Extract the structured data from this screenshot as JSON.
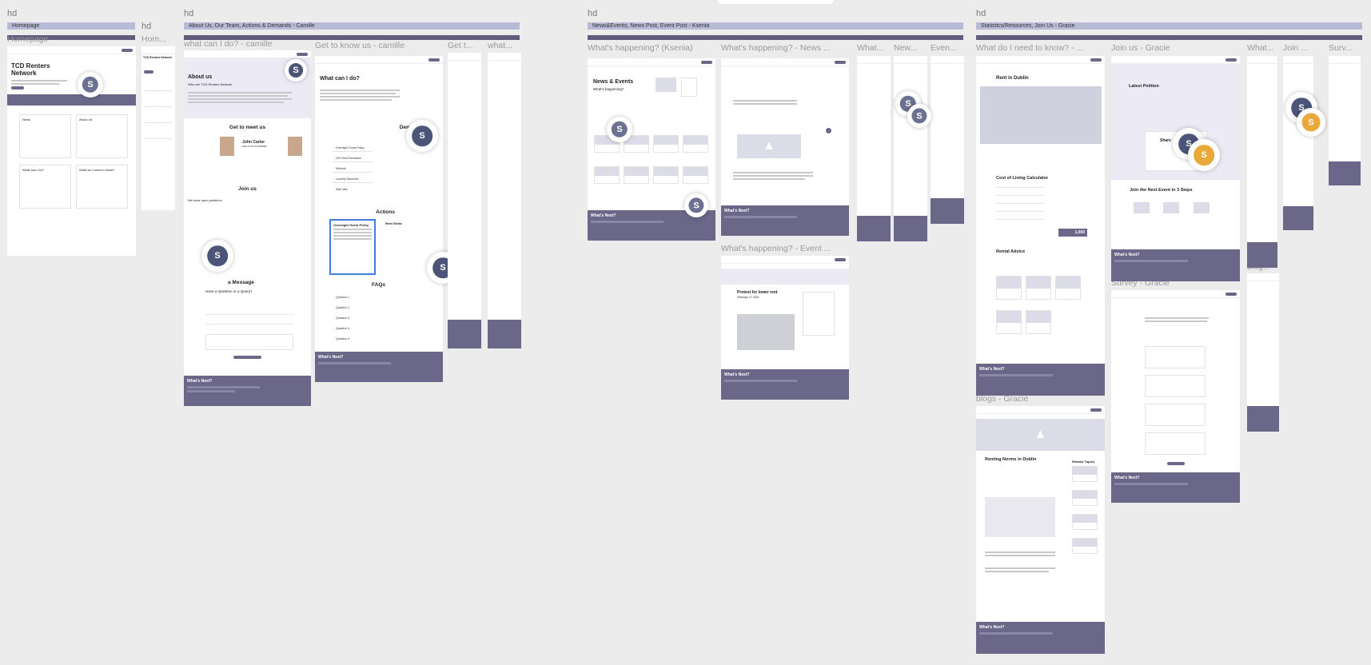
{
  "canvas": {
    "sections": [
      {
        "hd": "hd",
        "bar": "Homepage"
      },
      {
        "hd": "hd",
        "bar": "About Us, Our Team, Actions & Demands - Camille"
      },
      {
        "hd": "hd",
        "bar": "News&Events, News Post, Event Post - Ksenia"
      },
      {
        "hd": "hd",
        "bar": "Statistics/Resources, Join Us - Gracie"
      }
    ],
    "extra_hd": [
      "hd",
      "hd",
      "hd",
      "hd"
    ],
    "frame_labels": {
      "homepage": "Homepage",
      "homepage_mobile": "Hom...",
      "what_can_i_do": "what can I do? - camille",
      "get_to_know": "Get to know us - camille",
      "get_t": "Get t...",
      "what_mob": "what...",
      "whats_happening": "What's happening?  (Ksenia)",
      "whats_news": "What's happening? - News ...",
      "what_mob2": "What...",
      "new_mob": "New...",
      "even_mob": "Even...",
      "whats_event": "What's happening? - Event ...",
      "what_do_i_need": "What do I need to know? - ...",
      "join_us": "Join us - Gracie",
      "what_mob3": "What...",
      "join_mob": "Join ...",
      "surv_mob": "Surv...",
      "survey": "Survey - Gracie",
      "blogs": "blogs - Gracie",
      "blog_mob": "blog..."
    }
  },
  "avatar_letter": "S",
  "homepage": {
    "hero_title": "TCD Renters Network",
    "cards": [
      "News",
      "About Us",
      "What can I do?",
      "What do I need to know?"
    ]
  },
  "about": {
    "title": "About us",
    "subtitle": "Who are TCD Renters Network",
    "meet": "Get to meet us",
    "person_name": "John Carter",
    "person_role": "CEO & CO-FOUNDER",
    "join": "Join us",
    "open": "We have open positions",
    "message": "a Message",
    "question": "Have a Question or a Query?",
    "whats_next": "What's Next?"
  },
  "whatcan": {
    "title": "What can I do?",
    "demands": "Demands",
    "demand_items": [
      "Overnight Guest Policy",
      "20% Rent Reduction",
      "Refunds",
      "Laundry Machines",
      "Staff ratio"
    ],
    "actions": "Actions",
    "action_1": "Overnight Guest Policy",
    "action_2": "Rent Strike",
    "faqs": "FAQs",
    "faq_items": [
      "Question 1",
      "Question 2",
      "Question 3",
      "Question 4",
      "Question 5"
    ]
  },
  "news": {
    "title": "News & Events",
    "subtitle": "What's happening?",
    "post_title": "Protest for lower rent",
    "post_date": "February 17 2024"
  },
  "know": {
    "rent_title": "Rent in Dublin",
    "calc_title": "Cost of Living Calculator",
    "calc_value": "1,000",
    "advice_title": "Rental Advice"
  },
  "join": {
    "latest": "Latest Petition",
    "share": "Share",
    "next": "Join the Next Event in 3 Steps"
  },
  "blog": {
    "title": "Renting Norms in Dublin",
    "related": "Related Topics"
  }
}
